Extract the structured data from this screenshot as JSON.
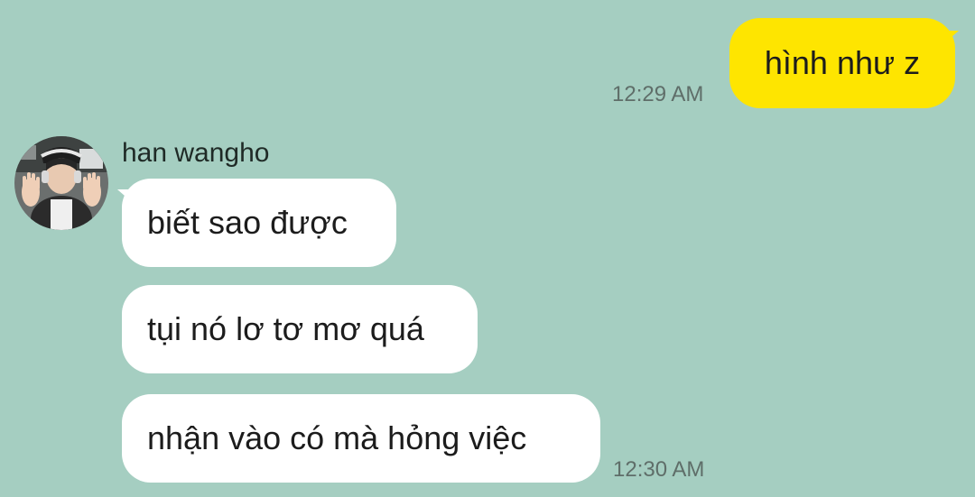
{
  "colors": {
    "background": "#a5cec1",
    "outgoing_bubble": "#fee500",
    "incoming_bubble": "#ffffff",
    "timestamp_text": "#5f6e69"
  },
  "outgoing": {
    "message": "hình như z",
    "time": "12:29 AM"
  },
  "incoming": {
    "sender": "han wangho",
    "avatar_icon": "profile-photo",
    "messages": [
      "biết sao được",
      "tụi nó lơ tơ mơ quá",
      "nhận vào có mà hỏng việc"
    ],
    "time": "12:30 AM"
  }
}
